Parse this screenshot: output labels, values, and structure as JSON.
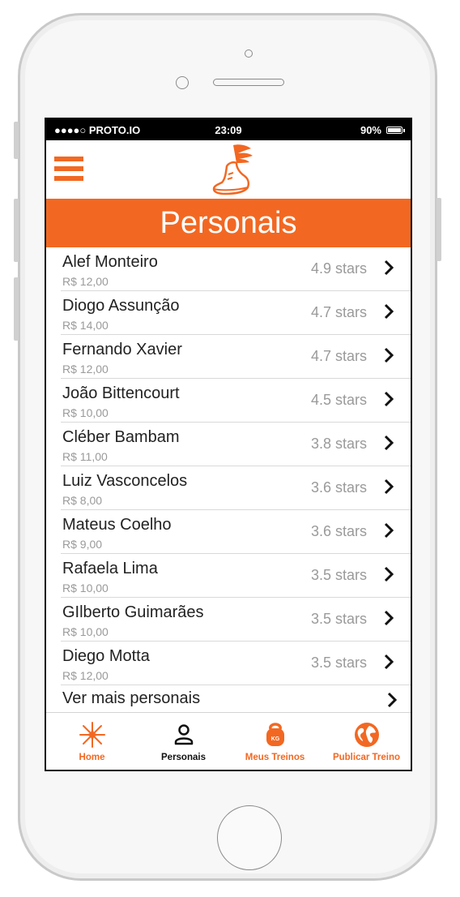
{
  "status_bar": {
    "carrier": "●●●●○ PROTO.IO",
    "time": "23:09",
    "battery": "90%",
    "battery_level": 0.9
  },
  "header": {
    "menu_icon": "hamburger-menu-icon",
    "logo_icon": "winged-shoe-logo-icon"
  },
  "title": "Personais",
  "colors": {
    "accent": "#f26822",
    "text": "#222222",
    "muted": "#9a9a9a",
    "tab_active": "#111111"
  },
  "trainers": [
    {
      "name": "Alef Monteiro",
      "price": "R$ 12,00",
      "rating": "4.9 stars"
    },
    {
      "name": "Diogo Assunção",
      "price": "R$ 14,00",
      "rating": "4.7 stars"
    },
    {
      "name": "Fernando Xavier",
      "price": "R$ 12,00",
      "rating": "4.7 stars"
    },
    {
      "name": "João Bittencourt",
      "price": "R$ 10,00",
      "rating": "4.5 stars"
    },
    {
      "name": "Cléber Bambam",
      "price": "R$ 11,00",
      "rating": "3.8 stars"
    },
    {
      "name": "Luiz Vasconcelos",
      "price": "R$ 8,00",
      "rating": "3.6 stars"
    },
    {
      "name": "Mateus Coelho",
      "price": "R$ 9,00",
      "rating": "3.6 stars"
    },
    {
      "name": "Rafaela Lima",
      "price": "R$ 10,00",
      "rating": "3.5 stars"
    },
    {
      "name": "GIlberto Guimarães",
      "price": "R$ 10,00",
      "rating": "3.5 stars"
    },
    {
      "name": "Diego Motta",
      "price": "R$ 12,00",
      "rating": "3.5 stars"
    }
  ],
  "see_more": "Ver mais personais",
  "tabs": [
    {
      "label": "Home",
      "icon": "star-burst-icon",
      "active": false
    },
    {
      "label": "Personais",
      "icon": "person-icon",
      "active": true
    },
    {
      "label": "Meus Treinos",
      "icon": "kettlebell-icon",
      "active": false
    },
    {
      "label": "Publicar Treino",
      "icon": "globe-icon",
      "active": false
    }
  ]
}
